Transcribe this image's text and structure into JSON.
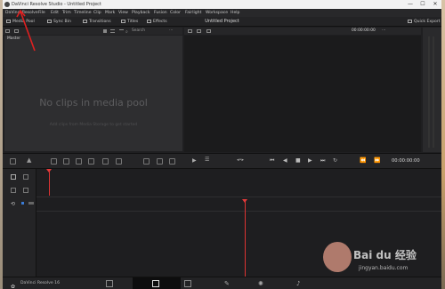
{
  "window": {
    "title": "DaVinci Resolve Studio - Untitled Project"
  },
  "menu": [
    "DaVinci Resolve",
    "File",
    "Edit",
    "Trim",
    "Timeline",
    "Clip",
    "Mark",
    "View",
    "Playback",
    "Fusion",
    "Color",
    "Fairlight",
    "Workspace",
    "Help"
  ],
  "toolbar": {
    "media_pool": "Media Pool",
    "sync_bin": "Sync Bin",
    "transitions": "Transitions",
    "titles": "Titles",
    "effects": "Effects",
    "project_title": "Untitled Project",
    "quick_export": "Quick Export"
  },
  "pool": {
    "bin": "Master",
    "search": "Search",
    "empty_message": "No clips in media pool",
    "empty_hint": "Add clips from Media Storage to get started"
  },
  "viewer": {
    "timecode_top": "00:00:00:00",
    "timecode_bottom": "00:00:00:00"
  },
  "transport": {
    "timecode": "00:00:00:00"
  },
  "status": {
    "app_name": "DaVinci Resolve 16"
  },
  "watermark": {
    "brand": "Bai du 经验",
    "url": "jingyan.baidu.com"
  }
}
